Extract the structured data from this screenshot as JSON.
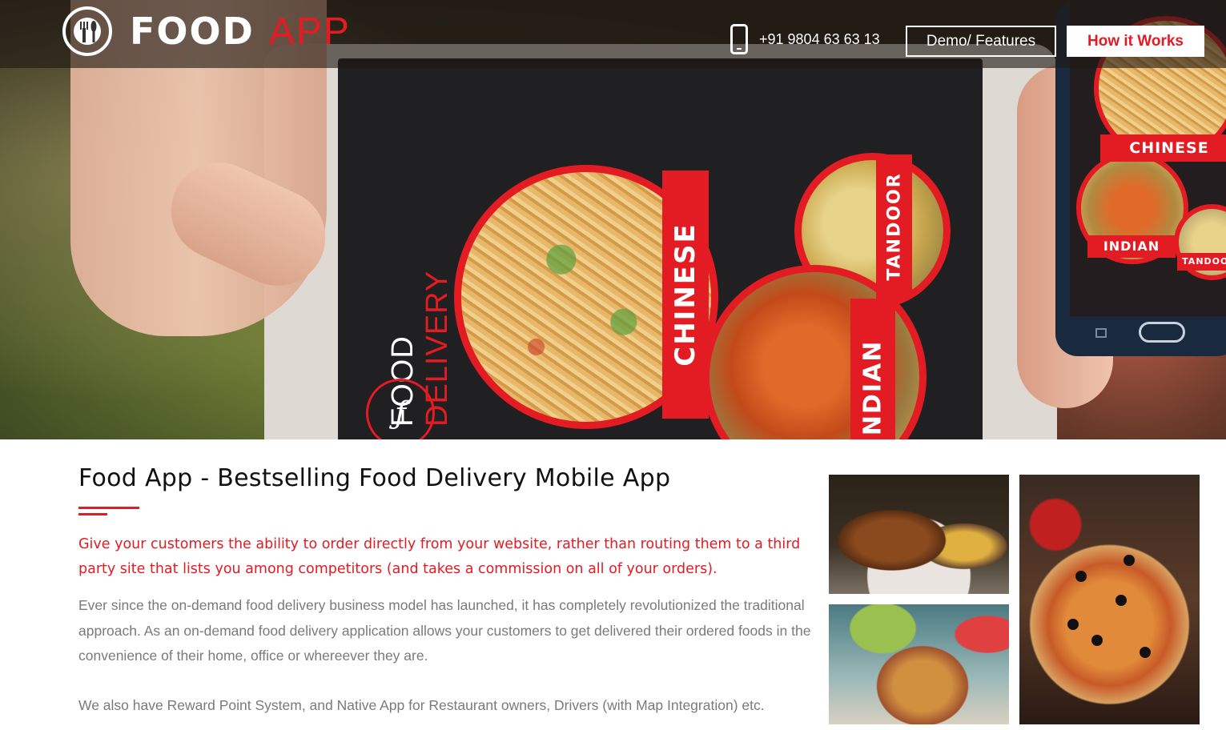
{
  "nav": {
    "logo_word": "FOOD",
    "logo_accent": "APP",
    "phone": "+91 9804 63 63 13",
    "demo_label": "Demo/ Features",
    "how_label": "How it Works"
  },
  "hero": {
    "vertical_title_white": "FOOD",
    "vertical_title_red": "DELIVERY",
    "labels": {
      "chinese": "CHINESE",
      "tandoor": "TANDOOR",
      "indian": "INDIAN"
    },
    "phone_labels": {
      "chinese": "CHINESE",
      "indian": "INDIAN",
      "tandoor": "TANDOOR"
    }
  },
  "main": {
    "title": "Food App - Bestselling Food Delivery Mobile App",
    "lead": "Give your customers the ability to order directly from your website, rather than routing them to a third party site that lists you among competitors (and takes a commission on all of your orders).",
    "para1": "Ever since the on-demand food delivery business model has launched, it has completely revolutionized the traditional approach. As an on-demand food delivery application allows your customers to get delivered their ordered foods in the convenience of their home, office or whereever they are.",
    "para2": "We also have Reward Point System, and Native App for Restaurant owners, Drivers (with Map Integration) etc."
  },
  "colors": {
    "accent": "#e31b23",
    "text_gray": "#7a7a7a",
    "title": "#111111"
  }
}
